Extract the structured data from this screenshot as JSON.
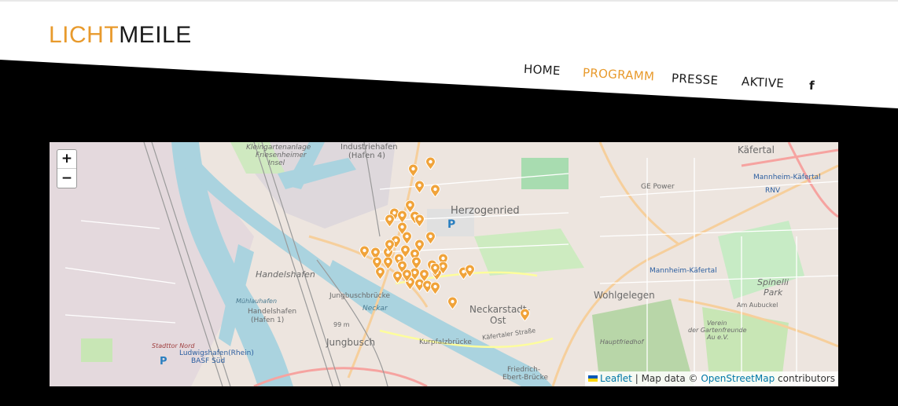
{
  "brand": {
    "part1": "LICHT",
    "part2": "MEILE"
  },
  "nav": {
    "items": [
      "HOME",
      "PROGRAMM",
      "PRESSE",
      "AKTIVE"
    ],
    "active": "PROGRAMM",
    "facebook": "f"
  },
  "map": {
    "zoom_in": "+",
    "zoom_out": "−",
    "labels": {
      "kleingarten": "Kleingartenanlage",
      "friesenheimer": "Friesenheimer",
      "insel": "Insel",
      "industriehafen": "Industriehafen",
      "hafen4": "(Hafen 4)",
      "herzogenried": "Herzogenried",
      "kafertal": "Käfertal",
      "mannheim_kafertal_bf": "Mannheim-Käfertal",
      "rnv": "RNV",
      "handelshafen": "Handelshafen",
      "mannheim_kafertal": "Mannheim-Käfertal",
      "wohlgelegen": "Wohlgelegen",
      "spinelli": "Spinelli",
      "park": "Park",
      "jungbuschbrucke": "Jungbuschbrücke",
      "neckarstadt_ost": "Neckarstadt-",
      "ost": "Ost",
      "mannheim_handelshafen": "Handelshafen",
      "hafen1": "(Hafen 1)",
      "kurpfalzbrucke": "Kurpfalzbrücke",
      "kafertaler_strasse": "Käfertaler Straße",
      "hauptfriedhof": "Hauptfriedhof",
      "jungbusch": "Jungbusch",
      "stadttor": "Stadttor Nord",
      "ludwigshafen": "Ludwigshafen(Rhein)",
      "basf": "BASF Süd",
      "friedrich_ebert": "Friedrich-",
      "ebert_brucke": "Ebert-Brücke",
      "am_aubuckel": "Am Aubuckel",
      "verein": "Verein",
      "gartenfreunde": "der Gartenfreunde",
      "au": "Au e.V.",
      "ge_power": "GE Power",
      "muhlauhafen": "Mühlauhafen",
      "neckar": "Neckar",
      "parking": "P",
      "parking2": "P",
      "m99": "99 m"
    },
    "attribution": {
      "leaflet": "Leaflet",
      "sep": " | Map data © ",
      "osm": "OpenStreetMap",
      "contributors": " contributors"
    },
    "colors": {
      "marker": "#f0a33a",
      "water": "#aad3df",
      "park": "#c8facc"
    }
  }
}
